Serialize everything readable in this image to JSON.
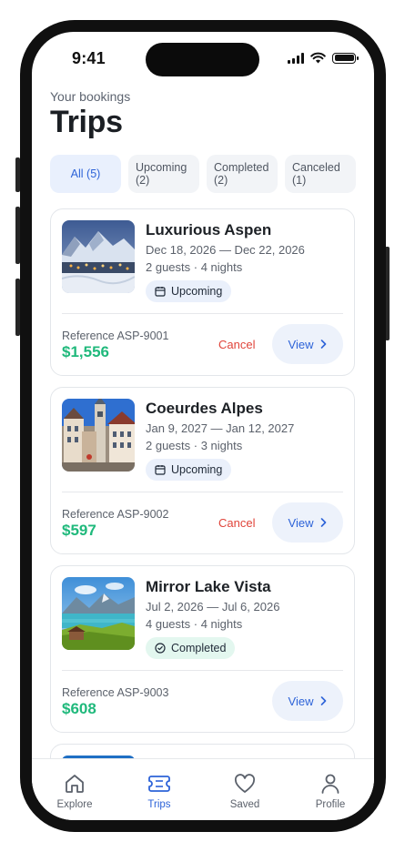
{
  "status": {
    "time": "9:41"
  },
  "header": {
    "eyebrow": "Your bookings",
    "title": "Trips"
  },
  "filters": [
    {
      "label": "All (5)",
      "active": true
    },
    {
      "label": "Upcoming (2)",
      "active": false
    },
    {
      "label": "Completed (2)",
      "active": false
    },
    {
      "label": "Canceled (1)",
      "active": false
    }
  ],
  "trips": [
    {
      "name": "Luxurious Aspen",
      "dates": "Dec 18, 2026 — Dec 22, 2026",
      "guests": "2 guests · 4 nights",
      "status": "Upcoming",
      "status_icon": "calendar-icon",
      "reference": "Reference ASP-9001",
      "price": "$1,556",
      "cancel_label": "Cancel",
      "view_label": "View"
    },
    {
      "name": "Coeurdes Alpes",
      "dates": "Jan 9, 2027 — Jan 12, 2027",
      "guests": "2 guests · 3 nights",
      "status": "Upcoming",
      "status_icon": "calendar-icon",
      "reference": "Reference ASP-9002",
      "price": "$597",
      "cancel_label": "Cancel",
      "view_label": "View"
    },
    {
      "name": "Mirror Lake Vista",
      "dates": "Jul 2, 2026 — Jul 6, 2026",
      "guests": "4 guests · 4 nights",
      "status": "Completed",
      "status_icon": "check-circle-icon",
      "reference": "Reference ASP-9003",
      "price": "$608",
      "view_label": "View"
    }
  ],
  "tabs": [
    {
      "label": "Explore",
      "icon": "home-icon",
      "active": false
    },
    {
      "label": "Trips",
      "icon": "ticket-icon",
      "active": true
    },
    {
      "label": "Saved",
      "icon": "heart-icon",
      "active": false
    },
    {
      "label": "Profile",
      "icon": "person-icon",
      "active": false
    }
  ],
  "colors": {
    "accent": "#2d63d8",
    "price": "#20b97c",
    "cancel": "#e0443a",
    "upcoming_badge": "#eaf0fb",
    "completed_badge": "#e3f7ef"
  }
}
